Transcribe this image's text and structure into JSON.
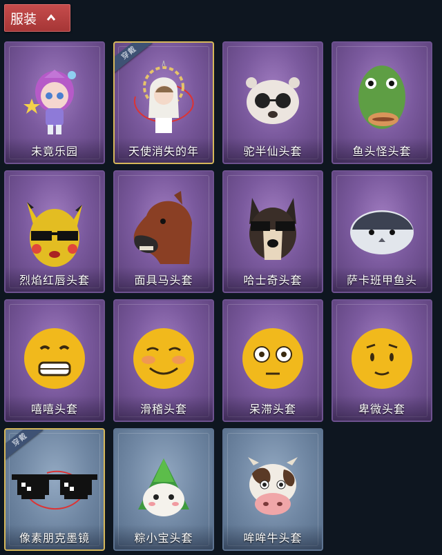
{
  "section": {
    "label": "服装"
  },
  "badges": {
    "equipped": "穿戴"
  },
  "items": [
    {
      "name": "未竟乐园"
    },
    {
      "name": "天使消失的年"
    },
    {
      "name": "驼半仙头套"
    },
    {
      "name": "鱼头怪头套"
    },
    {
      "name": "烈焰红唇头套"
    },
    {
      "name": "面具马头套"
    },
    {
      "name": "哈士奇头套"
    },
    {
      "name": "萨卡班甲鱼头"
    },
    {
      "name": "嘻嘻头套"
    },
    {
      "name": "滑稽头套"
    },
    {
      "name": "呆滞头套"
    },
    {
      "name": "卑微头套"
    },
    {
      "name": "像素朋克墨镜"
    },
    {
      "name": "粽小宝头套"
    },
    {
      "name": "哞哞牛头套"
    }
  ]
}
